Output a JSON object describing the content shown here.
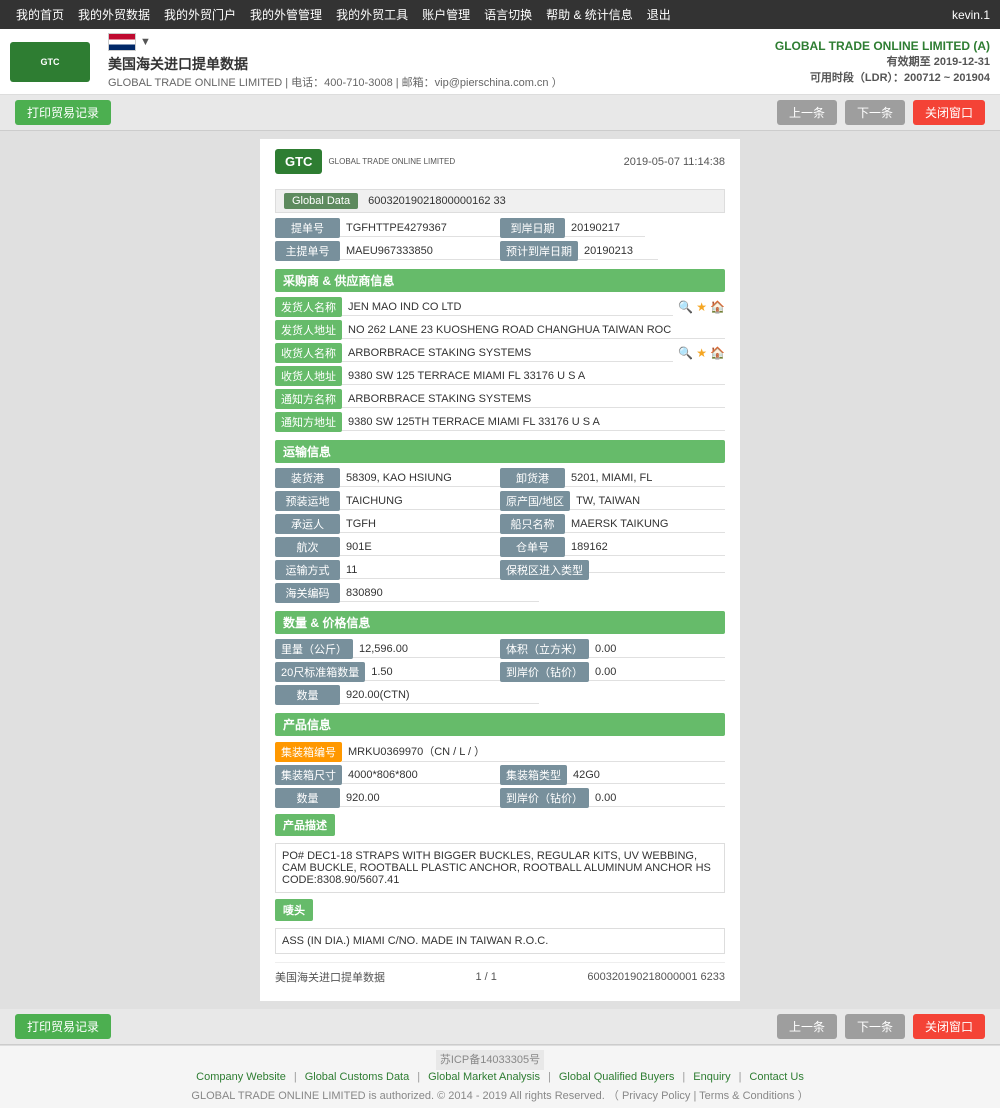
{
  "topnav": {
    "items": [
      "我的首页",
      "我的外贸数据",
      "我的外贸门户",
      "我的外管管理",
      "我的外贸工具",
      "账户管理",
      "语言切换",
      "帮助 & 统计信息",
      "退出"
    ],
    "user": "kevin.1"
  },
  "header": {
    "logo_text": "GLOBAL TRADE ONLINE LIMITED",
    "title": "美国海关进口提单数据",
    "subtitle": "GLOBAL TRADE ONLINE LIMITED | 电话：400-710-3008 | 邮箱：vip@pierschina.com.cn ）",
    "company": "GLOBAL TRADE ONLINE LIMITED (A)",
    "valid_until": "有效期至 2019-12-31",
    "ldr": "可用时段（LDR）：200712 ~ 201904"
  },
  "toolbar": {
    "print_btn": "打印贸易记录",
    "prev_btn": "上一条",
    "next_btn": "下一条",
    "close_btn": "关闭窗口"
  },
  "doc": {
    "date": "2019-05-07 11:14:38",
    "global_data_label": "Global Data",
    "global_data_value": "60032019021800000162 33",
    "fields": {
      "提单号_label": "提单号",
      "提单号_value": "TGFHTTPE4279367",
      "到岸日期_label": "到岸日期",
      "到岸日期_value": "20190217",
      "主提单号_label": "主提单号",
      "主提单号_value": "MAEU967333850",
      "预计到岸日期_label": "预计到岸日期",
      "预计到岸日期_value": "20190213"
    }
  },
  "buyer_supplier": {
    "section_title": "采购商 & 供应商信息",
    "fields": [
      {
        "label": "发货人名称",
        "value": "JEN MAO IND CO LTD",
        "has_icons": true
      },
      {
        "label": "发货人地址",
        "value": "NO 262 LANE 23 KUOSHENG ROAD CHANGHUA TAIWAN ROC",
        "has_icons": false
      },
      {
        "label": "收货人名称",
        "value": "ARBORBRACE STAKING SYSTEMS",
        "has_icons": true
      },
      {
        "label": "收货人地址",
        "value": "9380 SW 125 TERRACE MIAMI FL 33176 U S A",
        "has_icons": false
      },
      {
        "label": "通知方名称",
        "value": "ARBORBRACE STAKING SYSTEMS",
        "has_icons": false
      },
      {
        "label": "通知方地址",
        "value": "9380 SW 125TH TERRACE MIAMI FL 33176 U S A",
        "has_icons": false
      }
    ]
  },
  "shipping_info": {
    "section_title": "运输信息",
    "fields": [
      {
        "label": "装货港",
        "value": "58309, KAO HSIUNG",
        "label2": "卸货港",
        "value2": "5201, MIAMI, FL"
      },
      {
        "label": "预装运地",
        "value": "TAICHUNG",
        "label2": "原产国/地区",
        "value2": "TW, TAIWAN"
      },
      {
        "label": "承运人",
        "value": "TGFH",
        "label2": "船只名称",
        "value2": "MAERSK TAIKUNG"
      },
      {
        "label": "航次",
        "value": "901E",
        "label2": "仓单号",
        "value2": "189162"
      },
      {
        "label": "运输方式",
        "value": "11",
        "label2": "保税区进入类型",
        "value2": ""
      },
      {
        "label": "海关编码",
        "value": "830890",
        "label2": "",
        "value2": ""
      }
    ]
  },
  "price_info": {
    "section_title": "数量 & 价格信息",
    "fields": [
      {
        "label": "里量（公斤）",
        "value": "12,596.00",
        "label2": "体积（立方米）",
        "value2": "0.00"
      },
      {
        "label": "20尺标准箱数量",
        "value": "1.50",
        "label2": "到岸价（钻价）",
        "value2": "0.00"
      },
      {
        "label": "数量",
        "value": "920.00(CTN)",
        "label2": "",
        "value2": ""
      }
    ]
  },
  "product_info": {
    "section_title": "产品信息",
    "container_no_label": "集装箱编号",
    "container_no_value": "MRKU0369970（CN / L / ）",
    "container_size_label": "集装箱尺寸",
    "container_size_value": "4000*806*800",
    "container_type_label": "集装箱类型",
    "container_type_value": "42G0",
    "quantity_label": "数量",
    "quantity_value": "920.00",
    "arrival_price_label": "到岸价（钻价）",
    "arrival_price_value": "0.00",
    "product_desc_header": "产品描述",
    "product_desc": "PO# DEC1-18 STRAPS WITH BIGGER BUCKLES, REGULAR KITS, UV WEBBING, CAM BUCKLE, ROOTBALL PLASTIC ANCHOR, ROOTBALL ALUMINUM ANCHOR HS CODE:8308.90/5607.41",
    "remarks_header": "唛头",
    "remarks_value": "ASS (IN DIA.) MIAMI C/NO. MADE IN TAIWAN R.O.C."
  },
  "doc_footer": {
    "source": "美国海关进口提单数据",
    "page": "1 / 1",
    "doc_id": "600320190218000001 6233"
  },
  "bottom_toolbar": {
    "print_btn": "打印贸易记录",
    "prev_btn": "上一条",
    "next_btn": "下一条",
    "close_btn": "关闭窗口"
  },
  "page_footer": {
    "icp": "苏ICP备14033305号",
    "links": [
      "Company Website",
      "Global Customs Data",
      "Global Market Analysis",
      "Global Qualified Buyers",
      "Enquiry",
      "Contact Us"
    ],
    "copyright": "GLOBAL TRADE ONLINE LIMITED is authorized. © 2014 - 2019 All rights Reserved.  （  Privacy Policy  |  Terms & Conditions  ）"
  }
}
